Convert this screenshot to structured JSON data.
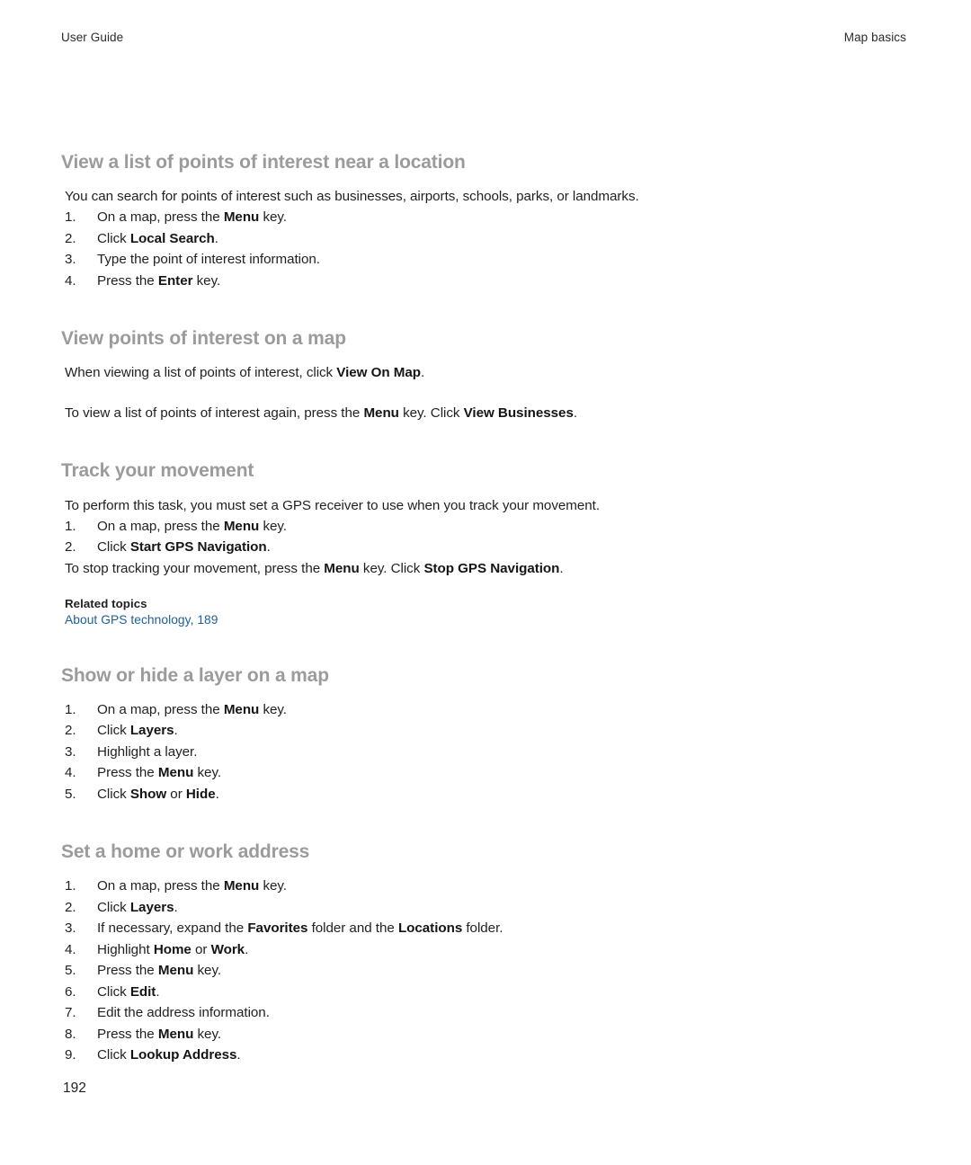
{
  "header": {
    "left": "User Guide",
    "right": "Map basics"
  },
  "colors": {
    "heading": "#9b9b9b",
    "body": "#231f20",
    "link": "#1f6099",
    "page_background": "#ffffff"
  },
  "sections": [
    {
      "heading": "View a list of points of interest near a location",
      "intro": "You can search for points of interest such as businesses, airports, schools, parks, or landmarks.",
      "steps": [
        "On a map, press the <strong>Menu</strong> key.",
        "Click <strong>Local Search</strong>.",
        "Type the point of interest information.",
        "Press the <strong>Enter</strong> key."
      ]
    },
    {
      "heading": "View points of interest on a map",
      "paragraphs": [
        "When viewing a list of points of interest, click <strong>View On Map</strong>.",
        "To view a list of points of interest again, press the <strong>Menu</strong> key. Click <strong>View Businesses</strong>."
      ]
    },
    {
      "heading": "Track your movement",
      "intro": "To perform this task, you must set a GPS receiver to use when you track your movement.",
      "steps": [
        "On a map, press the <strong>Menu</strong> key.",
        "Click <strong>Start GPS Navigation</strong>."
      ],
      "outro": "To stop tracking your movement, press the <strong>Menu</strong> key. Click <strong>Stop GPS Navigation</strong>.",
      "related": {
        "label": "Related topics",
        "link": "About GPS technology, 189"
      }
    },
    {
      "heading": "Show or hide a layer on a map",
      "steps": [
        "On a map, press the <strong>Menu</strong> key.",
        "Click <strong>Layers</strong>.",
        "Highlight a layer.",
        "Press the <strong>Menu</strong> key.",
        "Click <strong>Show</strong> or <strong>Hide</strong>."
      ]
    },
    {
      "heading": "Set a home or work address",
      "steps": [
        "On a map, press the <strong>Menu</strong> key.",
        "Click <strong>Layers</strong>.",
        "If necessary, expand the <strong>Favorites</strong> folder and the <strong>Locations</strong> folder.",
        "Highlight <strong>Home</strong> or <strong>Work</strong>.",
        "Press the <strong>Menu</strong> key.",
        "Click <strong>Edit</strong>.",
        "Edit the address information.",
        "Press the <strong>Menu</strong> key.",
        "Click <strong>Lookup Address</strong>."
      ]
    }
  ],
  "folio": "192"
}
